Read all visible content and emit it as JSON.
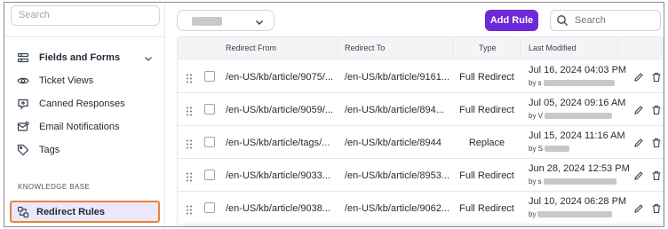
{
  "sidebar": {
    "search_placeholder": "Search",
    "items": [
      {
        "label": "Fields and Forms",
        "icon": "form-fields-icon"
      },
      {
        "label": "Ticket Views",
        "icon": "eye-icon"
      },
      {
        "label": "Canned Responses",
        "icon": "canned-response-icon"
      },
      {
        "label": "Email Notifications",
        "icon": "email-notification-icon"
      },
      {
        "label": "Tags",
        "icon": "tag-icon"
      }
    ],
    "section_label": "KNOWLEDGE BASE",
    "active_item": {
      "label": "Redirect Rules",
      "icon": "redirect-rules-icon"
    }
  },
  "toolbar": {
    "add_label": "Add Rule",
    "search_placeholder": "Search"
  },
  "table": {
    "columns": [
      "Redirect From",
      "Redirect To",
      "Type",
      "Last Modified"
    ],
    "rows": [
      {
        "from": "/en-US/kb/article/9075/...",
        "to": "/en-US/kb/article/9161...",
        "type": "Full Redirect",
        "date": "Jul 16, 2024 04:03 PM",
        "by_prefix": "by s"
      },
      {
        "from": "/en-US/kb/article/9059/...",
        "to": "/en-US/kb/article/894...",
        "type": "Full Redirect",
        "date": "Jul 05, 2024 09:16 AM",
        "by_prefix": "by V"
      },
      {
        "from": "/en-US/kb/article/tags/...",
        "to": "/en-US/kb/article/8944",
        "type": "Replace",
        "date": "Jul 15, 2024 11:16 AM",
        "by_prefix": "by S"
      },
      {
        "from": "/en-US/kb/article/9033...",
        "to": "/en-US/kb/article/8953...",
        "type": "Full Redirect",
        "date": "Jun 28, 2024 12:53 PM",
        "by_prefix": "by s"
      },
      {
        "from": "/en-US/kb/article/9038...",
        "to": "/en-US/kb/article/9062...",
        "type": "Full Redirect",
        "date": "Jul 10, 2024 06:28 PM",
        "by_prefix": "by"
      }
    ]
  },
  "colors": {
    "accent": "#6d28d9",
    "active_bg": "#ede7fb",
    "highlight_border": "#e8833a"
  }
}
